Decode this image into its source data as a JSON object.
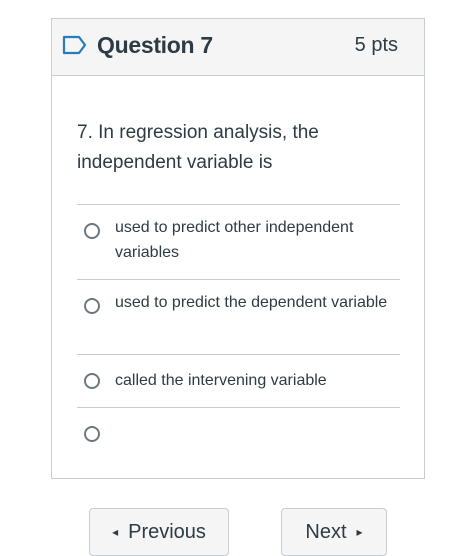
{
  "question": {
    "title": "Question 7",
    "points": "5 pts",
    "text": "7. In regression analysis, the independent variable is",
    "answers": [
      {
        "label": "used to predict other independent variables"
      },
      {
        "label": "used to predict the dependent variable"
      },
      {
        "label": "called the intervening variable"
      },
      {
        "label": ""
      }
    ]
  },
  "navigation": {
    "previous_label": "Previous",
    "next_label": "Next",
    "previous_arrow": "◂",
    "next_arrow": "▸"
  },
  "colors": {
    "text": "#2d3b45",
    "border": "#c7cdd1",
    "header_bg": "#f5f5f5",
    "flag": "#2b7abc"
  }
}
